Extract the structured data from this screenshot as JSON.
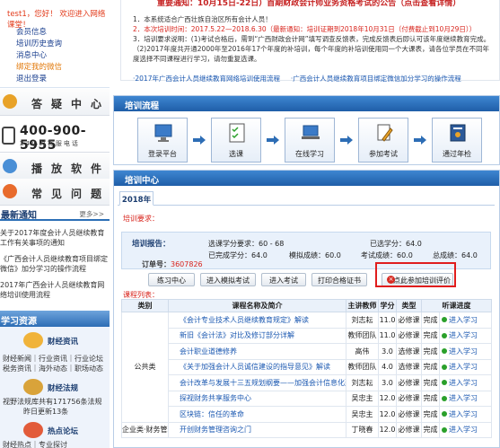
{
  "left": {
    "welcome": "test1，您好！  欢迎进入网络课堂！",
    "menu": [
      "会员信息",
      "培训历史查询",
      "消息中心",
      "绑定我的微信",
      "退出登录"
    ],
    "buttons": [
      "答疑中心",
      "播放软件",
      "常见问题"
    ],
    "hotline": {
      "number": "400-900-5955",
      "sub": "24小时客服电话"
    },
    "notice": {
      "title": "最新通知",
      "more": "更多>>",
      "items": [
        "关于2017年度会计人员继续教育工作有关事项的通知",
        "《广西会计人员继续教育项目绑定微信》加分学习的操作流程",
        "2017年广西会计人员继续教育网络培训使用流程"
      ]
    },
    "resources": {
      "title": "学习资源",
      "news": {
        "title": "财经资讯",
        "links": "财经新闻｜行业资讯｜行业论坛    税务资讯｜海外动态｜职场动态"
      },
      "law": {
        "title": "财经法规",
        "line1": "视野法规库共有171756条法规",
        "line2": "昨日更新13条"
      },
      "forum": {
        "title": "热点论坛",
        "line": "财经热点｜专业探讨"
      }
    }
  },
  "top": {
    "headline": "重要通知：10月15日-22日）首期财政会计师业务资格考试的公告（点击查看详情）",
    "lines": [
      "1．本系统适合广西壮族自治区所有会计人员！",
      "2．本次培训时间：2017.5.22—2018.6.30（最新通知：培训证期到2018年10月31日（付费截止到10月29日））",
      "3．培训要求说明：(1)考试合格后，需到“广西财政会计网”填写调查反馈表，完成反馈表后即认可该年度继续教育完成。",
      "（2)2017年度共开通2000年至2016年17个年度的补培训，每个年度的补培训使用同一个大课表，请各位学员在不同年度选择不同课程进行学习，请勿重复选课。"
    ],
    "links": [
      "·2017年广西会计人员继续教育网络培训使用流程",
      "·广西会计人员继续教育项目绑定微信加分学习的操作流程"
    ]
  },
  "flow": {
    "title": "培训流程",
    "steps": [
      "登录平台",
      "选课",
      "在线学习",
      "参加考试",
      "通过年检"
    ]
  },
  "center": {
    "title": "培训中心",
    "tab": "2018年",
    "requirement": "培训要求：",
    "report": {
      "title": "培训报告：",
      "order_label": "订单号：",
      "order_no": "3607826",
      "f1": "选课学分要求：60 - 68",
      "f2": "已选学分：64.0",
      "f3": "已完成学分：64.0",
      "f4": "模拟成绩：60.0",
      "f5": "考试成绩：60.0",
      "f6": "总成绩：64.0"
    },
    "buttons": [
      "练习中心",
      "进入模拟考试",
      "进入考试",
      "打印合格证书",
      "点此参加培训评价"
    ],
    "course_list_label": "课程列表：",
    "table": {
      "headers": [
        "类别",
        "课程名称及简介",
        "主讲教师",
        "学分",
        "类型",
        "听课进度"
      ],
      "category_public": "公共类",
      "category_biz": "企业类·财务管理",
      "rows": [
        [
          "《会计专业技术人员继续教育规定》解读",
          "刘志耘",
          "11.0",
          "必修课",
          "完成",
          "进入学习"
        ],
        [
          "新旧《会计法》对比及修订部分详解",
          "教师团队",
          "11.0",
          "必修课",
          "完成",
          "进入学习"
        ],
        [
          "会计职业道德修养",
          "高伟",
          "3.0",
          "选修课",
          "完成",
          "进入学习"
        ],
        [
          "《关于加强会计人员诚信建设的指导意见》解读",
          "教师团队",
          "4.0",
          "选修课",
          "完成",
          "进入学习"
        ],
        [
          "会计改革与发展十三五规划纲要——加强会计信息化建设",
          "刘志耘",
          "3.0",
          "必修课",
          "完成",
          "进入学习"
        ],
        [
          "探视财务共享服务中心",
          "吴忠主",
          "12.0",
          "必修课",
          "完成",
          "进入学习"
        ],
        [
          "区块链：信任的革命",
          "吴忠主",
          "12.0",
          "必修课",
          "完成",
          "进入学习"
        ],
        [
          "开创财务管理咨询之门",
          "丁晓春",
          "12.0",
          "必修课",
          "完成",
          "进入学习"
        ]
      ]
    }
  }
}
